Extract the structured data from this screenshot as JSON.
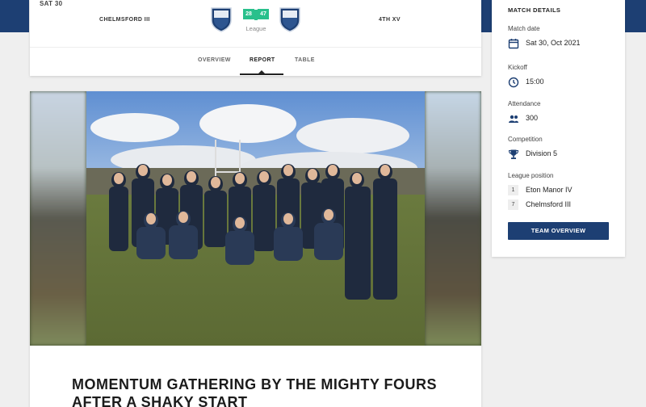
{
  "header": {
    "date_label": "SAT 30",
    "home_team": "CHELMSFORD III",
    "away_team": "4TH XV",
    "score_home": "28",
    "score_away": "47",
    "competition_label": "League",
    "tabs": [
      {
        "label": "OVERVIEW",
        "active": false
      },
      {
        "label": "REPORT",
        "active": true
      },
      {
        "label": "TABLE",
        "active": false
      }
    ]
  },
  "article": {
    "photo": "team-celebration-photo",
    "headline": "MOMENTUM GATHERING BY THE MIGHTY FOURS AFTER A SHAKY START"
  },
  "details": {
    "title": "MATCH DETAILS",
    "match_date_label": "Match date",
    "match_date_value": "Sat 30, Oct 2021",
    "kickoff_label": "Kickoff",
    "kickoff_value": "15:00",
    "attendance_label": "Attendance",
    "attendance_value": "300",
    "competition_label": "Competition",
    "competition_value": "Division 5",
    "league_position_label": "League position",
    "positions": [
      {
        "rank": "1",
        "team": "Eton Manor IV"
      },
      {
        "rank": "7",
        "team": "Chelmsford III"
      }
    ],
    "button_label": "TEAM OVERVIEW"
  },
  "colors": {
    "brand_navy": "#1d3f73",
    "score_green": "#29c08c",
    "page_bg": "#efefef"
  }
}
